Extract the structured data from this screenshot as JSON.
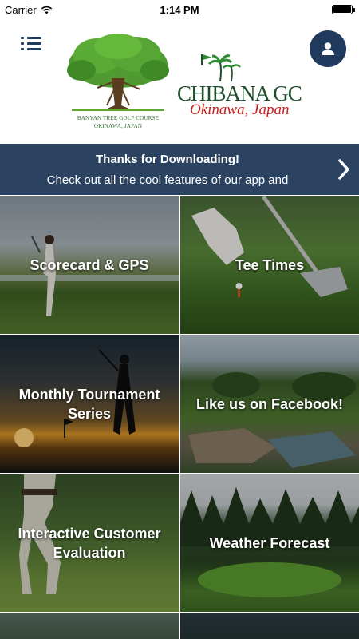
{
  "status_bar": {
    "carrier": "Carrier",
    "time": "1:14 PM",
    "battery_level": 1.0
  },
  "header": {
    "menu_icon": "menu-list-icon",
    "profile_icon": "user-icon",
    "logos": {
      "banyan": {
        "caption_line1": "BANYAN TREE GOLF COURSE",
        "caption_line2": "OKINAWA, JAPAN"
      },
      "chibana": {
        "wordmark": "CHIBANA GC",
        "subline": "Okinawa, Japan"
      }
    }
  },
  "banner": {
    "title": "Thanks for Downloading!",
    "text": "Check out all the cool features of our app and",
    "arrow_icon": "chevron-right-icon",
    "background": "#2b4260"
  },
  "tiles": [
    {
      "label": "Scorecard & GPS"
    },
    {
      "label": "Tee Times"
    },
    {
      "label": "Monthly Tournament Series"
    },
    {
      "label": "Like us on Facebook!"
    },
    {
      "label": "Interactive Customer Evaluation"
    },
    {
      "label": "Weather Forecast"
    },
    {
      "label": ""
    },
    {
      "label": ""
    }
  ],
  "colors": {
    "navy": "#1f3a5c",
    "banner": "#2b4260",
    "logo_green": "#1d4e2a",
    "logo_red": "#cc1a1a"
  }
}
